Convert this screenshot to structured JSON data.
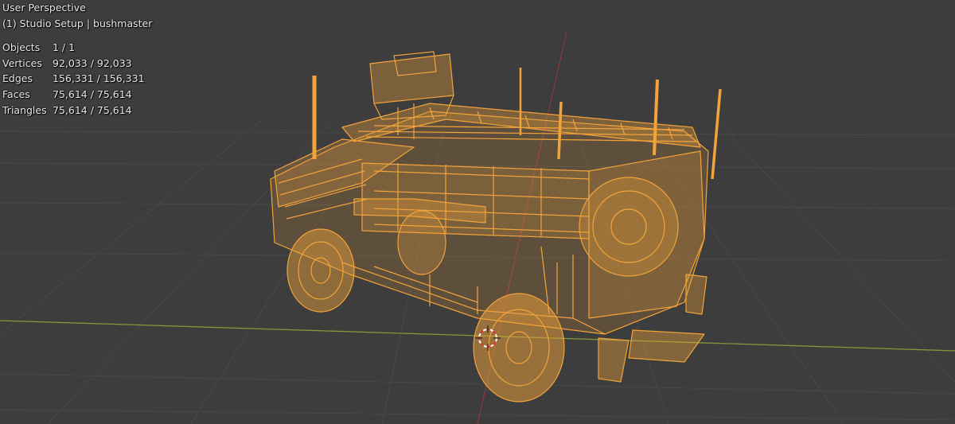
{
  "viewport": {
    "view_name": "User Perspective",
    "collection_label": "(1) Studio Setup | bushmaster",
    "stats": [
      {
        "label": "Objects",
        "value": "1 / 1"
      },
      {
        "label": "Vertices",
        "value": "92,033 / 92,033"
      },
      {
        "label": "Edges",
        "value": "156,331 / 156,331"
      },
      {
        "label": "Faces",
        "value": "75,614 / 75,614"
      },
      {
        "label": "Triangles",
        "value": "75,614 / 75,614"
      }
    ]
  },
  "colors": {
    "background": "#3d3d3d",
    "grid": "#484848",
    "x_axis": "#7e9a3a",
    "y_axis": "#8c3838",
    "wireframe": "#f2a33a",
    "text": "#e8e8e8"
  },
  "icons": {
    "cursor": "3d-cursor-icon"
  }
}
